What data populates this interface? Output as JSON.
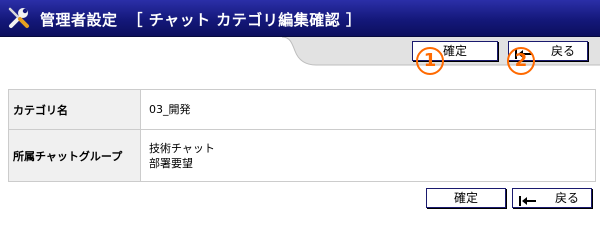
{
  "header": {
    "title": "管理者設定",
    "subtitle": "［ チャット カテゴリ編集確認 ］",
    "icon": "tools-icon"
  },
  "toolbar_top": {
    "confirm_label": "確定",
    "back_label": "戻る"
  },
  "annotations": {
    "marker1": "1",
    "marker2": "2",
    "color": "#ff6a00"
  },
  "form": {
    "rows": [
      {
        "label": "カテゴリ名",
        "values": [
          "03_開発"
        ]
      },
      {
        "label": "所属チャットグループ",
        "values": [
          "技術チャット",
          "部署要望"
        ]
      }
    ]
  },
  "toolbar_bottom": {
    "confirm_label": "確定",
    "back_label": "戻る"
  },
  "colors": {
    "header_bg": "#14187a",
    "label_bg": "#f0f0f0",
    "border": "#cccccc"
  }
}
